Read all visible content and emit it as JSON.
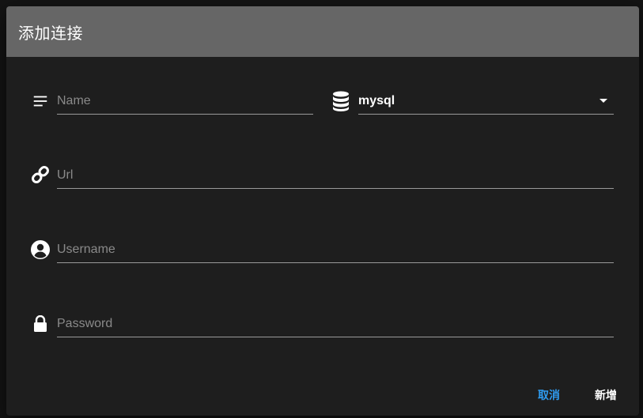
{
  "dialog": {
    "title": "添加连接"
  },
  "form": {
    "name": {
      "placeholder": "Name",
      "icon": "subject-icon"
    },
    "db_type": {
      "value": "mysql",
      "icon": "database-icon"
    },
    "url": {
      "placeholder": "Url",
      "icon": "link-icon"
    },
    "username": {
      "placeholder": "Username",
      "icon": "account-circle-icon"
    },
    "password": {
      "placeholder": "Password",
      "icon": "lock-icon"
    }
  },
  "actions": {
    "cancel_label": "取消",
    "add_label": "新增"
  },
  "colors": {
    "header_bg": "#666666",
    "dialog_bg": "#1e1e1e",
    "accent": "#2f9cf1",
    "text": "#ffffff",
    "placeholder": "#8a8a8a"
  }
}
